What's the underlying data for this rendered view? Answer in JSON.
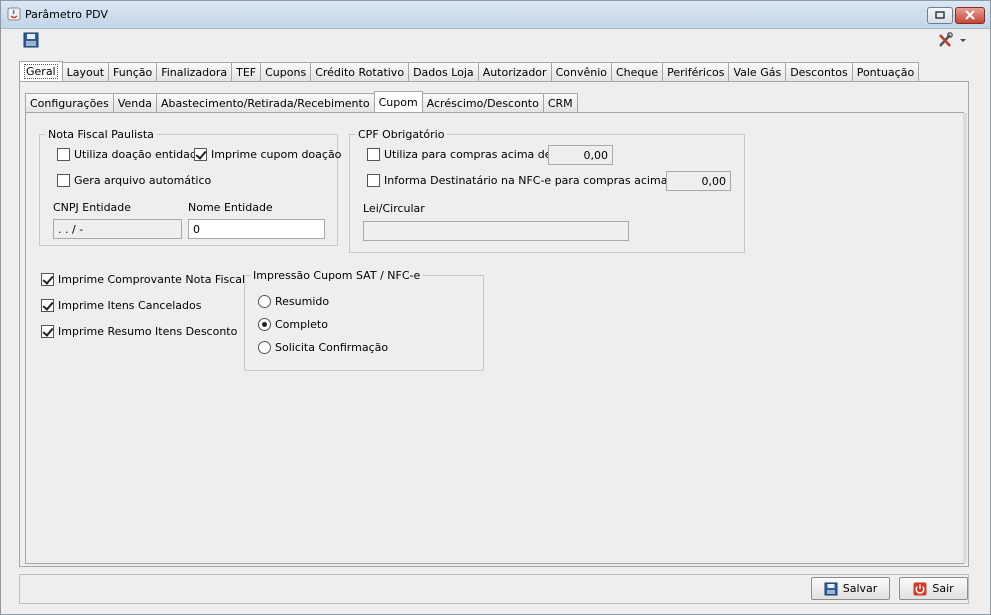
{
  "window": {
    "title": "Parâmetro PDV"
  },
  "tabs": [
    "Geral",
    "Layout",
    "Função",
    "Finalizadora",
    "TEF",
    "Cupons",
    "Crédito Rotativo",
    "Dados Loja",
    "Autorizador",
    "Convênio",
    "Cheque",
    "Periféricos",
    "Vale Gás",
    "Descontos",
    "Pontuação"
  ],
  "subtabs": [
    "Configurações",
    "Venda",
    "Abastecimento/Retirada/Recebimento",
    "Cupom",
    "Acréscimo/Desconto",
    "CRM"
  ],
  "nfp": {
    "legend": "Nota Fiscal Paulista",
    "doacao_label": "Utiliza doação entidade",
    "imprime_doacao_label": "Imprime cupom doação",
    "gera_arquivo_label": "Gera arquivo automático",
    "cnpj_label": "CNPJ Entidade",
    "cnpj_value": " .  .  /  -",
    "nome_label": "Nome Entidade",
    "nome_value": "0"
  },
  "cpf": {
    "legend": "CPF Obrigatório",
    "compras_label": "Utiliza para compras acima de R$",
    "compras_value": "0,00",
    "destinatario_label": "Informa Destinatário na NFC-e para compras acima de R$",
    "destinatario_value": "0,00",
    "lei_label": "Lei/Circular",
    "lei_value": ""
  },
  "options": {
    "comprovante_label": "Imprime Comprovante Nota Fiscal",
    "cancelados_label": "Imprime Itens Cancelados",
    "resumo_label": "Imprime Resumo Itens Desconto"
  },
  "impressao": {
    "legend": "Impressão Cupom SAT / NFC-e",
    "resumido": "Resumido",
    "completo": "Completo",
    "solicita": "Solicita Confirmação"
  },
  "buttons": {
    "salvar": "Salvar",
    "sair": "Sair"
  }
}
